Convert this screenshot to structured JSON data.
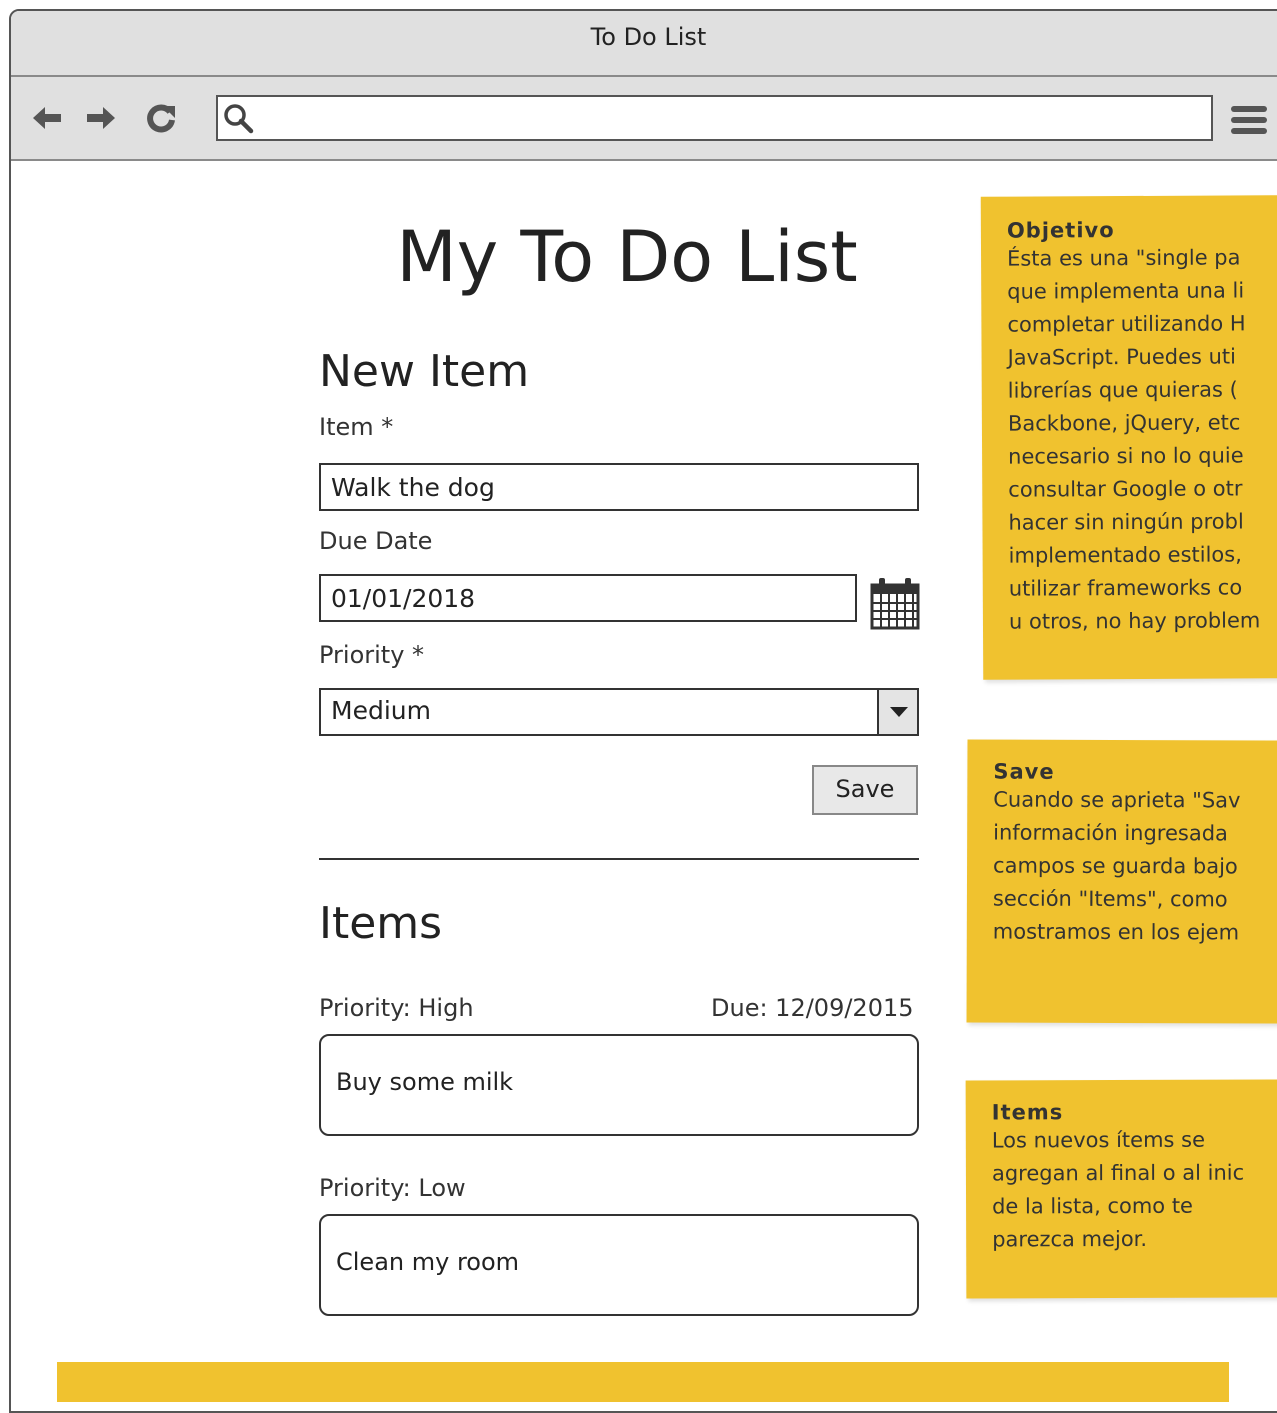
{
  "window": {
    "title": "To Do List"
  },
  "browser": {
    "address_value": ""
  },
  "page": {
    "title": "My To Do List"
  },
  "new_item": {
    "heading": "New Item",
    "item_label": "Item *",
    "item_value": "Walk the dog",
    "due_label": "Due Date",
    "due_value": "01/01/2018",
    "priority_label": "Priority *",
    "priority_value": "Medium",
    "save_label": "Save"
  },
  "items": {
    "heading": "Items",
    "list": [
      {
        "priority": "Priority: High",
        "due": "Due: 12/09/2015",
        "text": "Buy some milk"
      },
      {
        "priority": "Priority: Low",
        "due": "",
        "text": "Clean my room"
      }
    ]
  },
  "notes": {
    "objetivo": {
      "title": "Objetivo",
      "body": "Ésta es una \"single pa\nque implementa una li\ncompletar utilizando H\nJavaScript. Puedes uti\nlibrerías que quieras (\nBackbone, jQuery, etc\nnecesario si no lo quie\nconsultar Google o otr\nhacer sin ningún probl\nimplementado estilos,\nutilizar frameworks co\nu otros, no hay problem"
    },
    "save": {
      "title": "Save",
      "body": "Cuando se aprieta \"Sav\ninformación ingresada \ncampos se guarda bajo\nsección \"Items\", como \nmostramos en los ejem"
    },
    "items": {
      "title": "Items",
      "body": "Los nuevos ítems se\nagregan al final o al inic\nde la lista, como te\nparezca mejor."
    }
  },
  "colors": {
    "note": "#f0c22f",
    "chrome": "#e0e0e0",
    "text": "#333333"
  }
}
